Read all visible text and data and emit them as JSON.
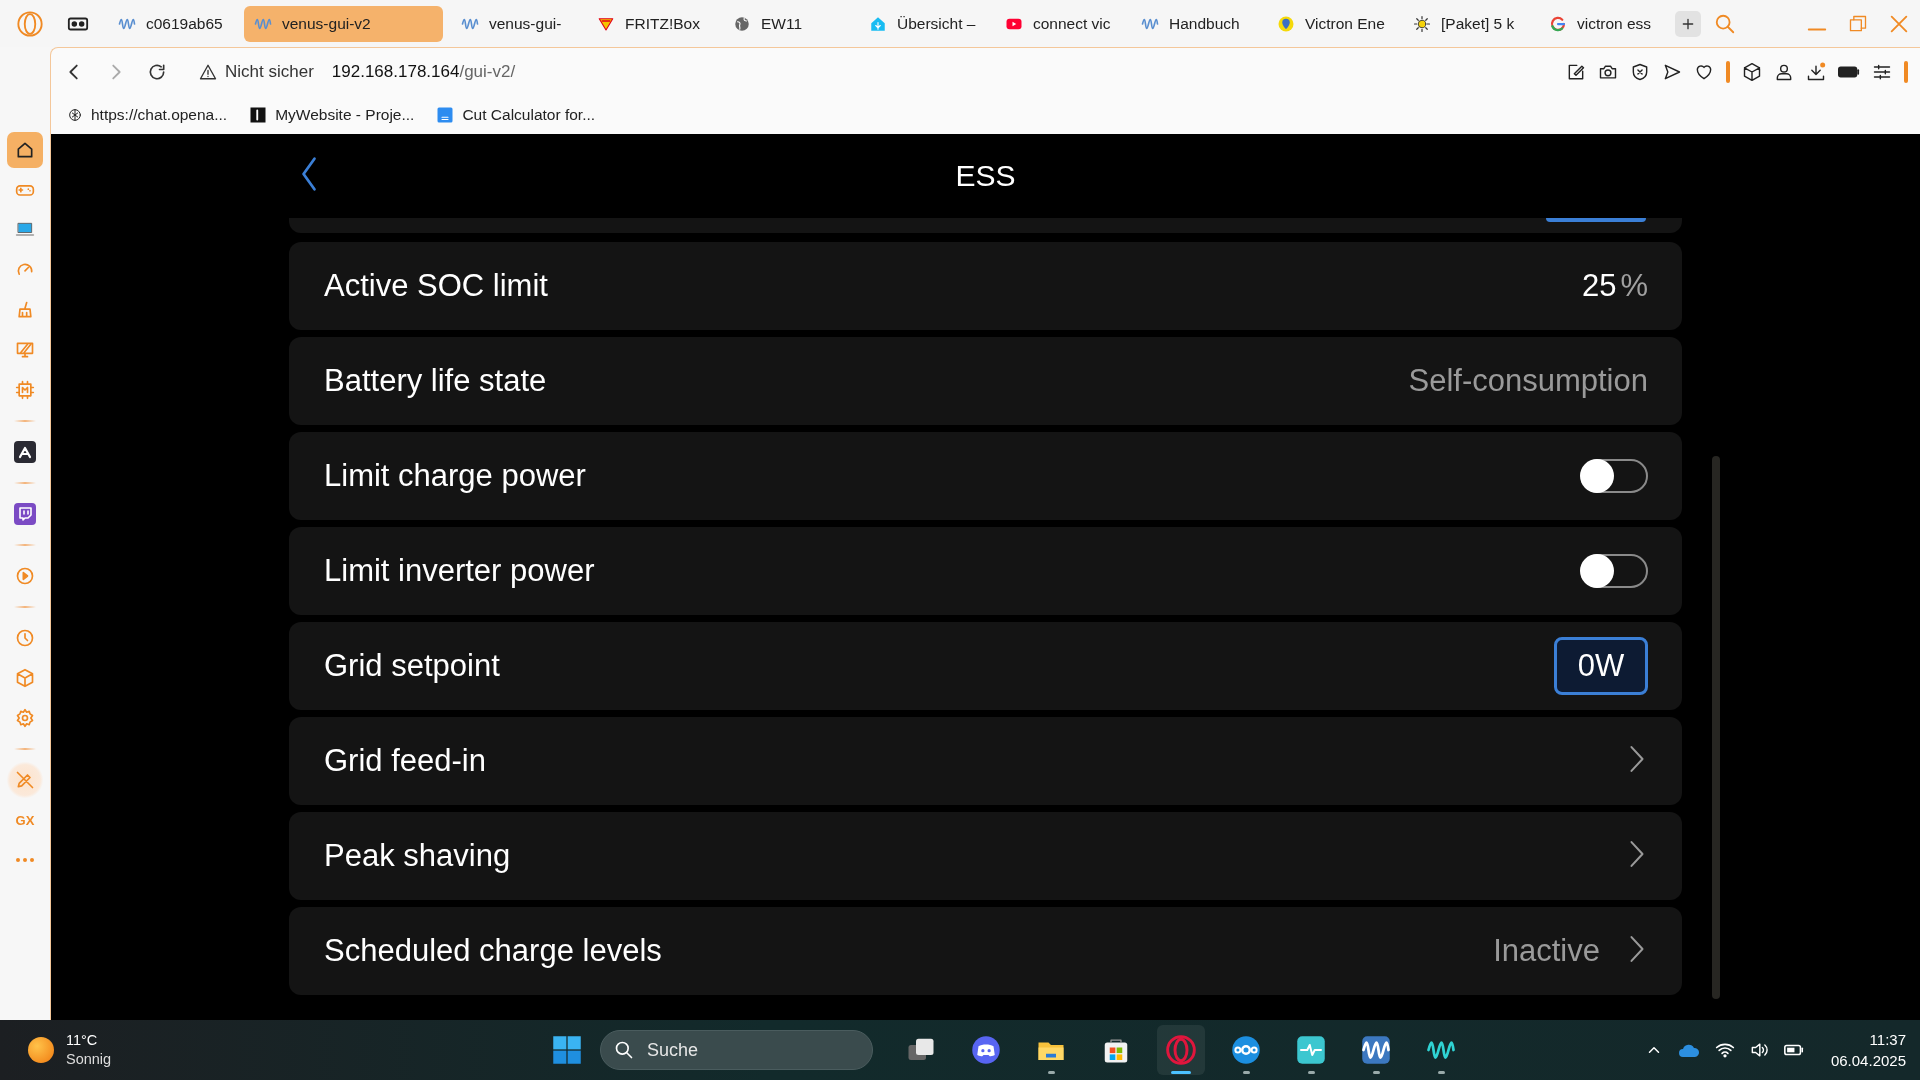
{
  "browser": {
    "tabs": [
      {
        "kind": "victron",
        "label": "c0619ab65",
        "selected": false
      },
      {
        "kind": "victron",
        "label": "venus-gui-v2",
        "selected": true
      },
      {
        "kind": "victron",
        "label": "venus-gui-",
        "selected": false
      },
      {
        "kind": "fritz",
        "label": "FRITZ!Box",
        "selected": false
      },
      {
        "kind": "globe",
        "label": "EW11",
        "selected": false
      },
      {
        "kind": "house",
        "label": "Übersicht –",
        "selected": false
      },
      {
        "kind": "youtube",
        "label": "connect vic",
        "selected": false
      },
      {
        "kind": "victron",
        "label": "Handbuch",
        "selected": false
      },
      {
        "kind": "pin",
        "label": "Victron Ene",
        "selected": false
      },
      {
        "kind": "sun",
        "label": "[Paket] 5 k",
        "selected": false
      },
      {
        "kind": "google",
        "label": "victron ess",
        "selected": false
      }
    ],
    "address": {
      "security": "Nicht sicher",
      "host": "192.168.178.164",
      "path": "/gui-v2/"
    },
    "bookmarks": [
      {
        "kind": "chat",
        "label": "https://chat.opena..."
      },
      {
        "kind": "dark",
        "label": "MyWebsite - Proje..."
      },
      {
        "kind": "doc",
        "label": "Cut Calculator for..."
      }
    ],
    "sidebar": {
      "groups": [
        [
          {
            "kind": "home",
            "selected": true
          },
          {
            "kind": "gamepad",
            "selected": false
          },
          {
            "kind": "laptop",
            "selected": false
          },
          {
            "kind": "gauge",
            "selected": false
          },
          {
            "kind": "broom",
            "selected": false
          },
          {
            "kind": "monitor",
            "selected": false
          },
          {
            "kind": "chip",
            "selected": false
          }
        ],
        [
          {
            "kind": "arch",
            "selected": false
          }
        ],
        [
          {
            "kind": "twitch",
            "selected": false
          }
        ],
        [
          {
            "kind": "play",
            "selected": false
          }
        ],
        [
          {
            "kind": "clock",
            "selected": false
          },
          {
            "kind": "cube",
            "selected": false
          },
          {
            "kind": "gear",
            "selected": false
          }
        ],
        [
          {
            "kind": "pen",
            "selected": false
          },
          {
            "kind": "text",
            "label": "GX",
            "selected": false
          },
          {
            "kind": "more",
            "selected": false
          }
        ]
      ]
    }
  },
  "page": {
    "title": "ESS",
    "rows": [
      {
        "kind": "clipped"
      },
      {
        "kind": "value",
        "label": "Active SOC limit",
        "value": "25",
        "unit": "%"
      },
      {
        "kind": "text",
        "label": "Battery life state",
        "value": "Self-consumption"
      },
      {
        "kind": "switch",
        "label": "Limit charge power",
        "on": false
      },
      {
        "kind": "switch",
        "label": "Limit inverter power",
        "on": false
      },
      {
        "kind": "button",
        "label": "Grid setpoint",
        "value": "0W"
      },
      {
        "kind": "link",
        "label": "Grid feed-in"
      },
      {
        "kind": "link",
        "label": "Peak shaving"
      },
      {
        "kind": "link",
        "label": "Scheduled charge levels",
        "value": "Inactive"
      }
    ]
  },
  "taskbar": {
    "weather": {
      "temp": "11°C",
      "text": "Sonnig"
    },
    "search": {
      "placeholder": "Suche"
    },
    "apps": [
      {
        "kind": "taskview",
        "running": false,
        "selected": false
      },
      {
        "kind": "discord",
        "running": false,
        "selected": false
      },
      {
        "kind": "explorer",
        "running": true,
        "selected": false
      },
      {
        "kind": "store",
        "running": false,
        "selected": false
      },
      {
        "kind": "opera",
        "running": true,
        "selected": true
      },
      {
        "kind": "nextcloud",
        "running": true,
        "selected": false
      },
      {
        "kind": "pulse",
        "running": true,
        "selected": false
      },
      {
        "kind": "victron",
        "running": true,
        "selected": false
      },
      {
        "kind": "waves",
        "running": true,
        "selected": false
      }
    ],
    "clock": {
      "time": "11:37",
      "date": "06.04.2025"
    }
  }
}
